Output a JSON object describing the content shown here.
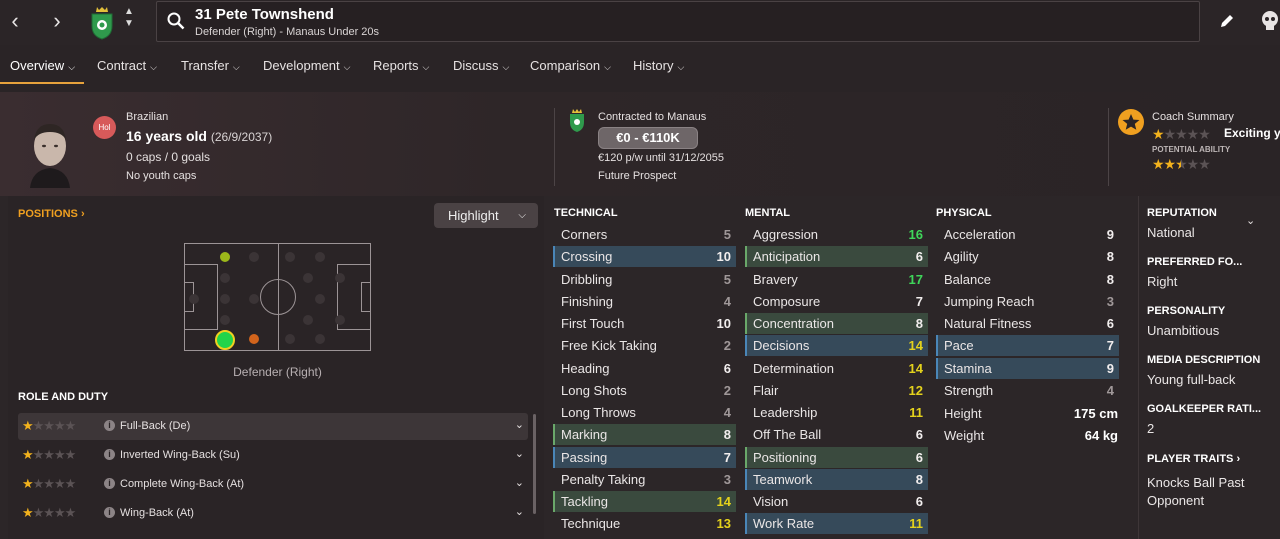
{
  "header": {
    "player_title": "31 Pete Townshend",
    "player_subtitle": "Defender (Right) - Manaus Under 20s"
  },
  "tabs": [
    {
      "label": "Overview"
    },
    {
      "label": "Contract"
    },
    {
      "label": "Transfer"
    },
    {
      "label": "Development"
    },
    {
      "label": "Reports"
    },
    {
      "label": "Discuss"
    },
    {
      "label": "Comparison"
    },
    {
      "label": "History"
    }
  ],
  "profile": {
    "nationality": "Brazilian",
    "nation_code": "Hol",
    "age": "16 years old",
    "dob": "(26/9/2037)",
    "caps": "0 caps / 0 goals",
    "youth_caps": "No youth caps"
  },
  "contract": {
    "contracted": "Contracted to Manaus",
    "value": "€0 - €110K",
    "wage": "€120 p/w until 31/12/2055",
    "status": "Future Prospect"
  },
  "coach": {
    "title": "Coach Summary",
    "verdict": "Exciting y",
    "current_stars": 1,
    "pa_label": "POTENTIAL ABILITY",
    "potential_stars": 2.5
  },
  "positions": {
    "link": "POSITIONS",
    "highlight_label": "Highlight",
    "caption": "Defender (Right)"
  },
  "roles": {
    "title": "ROLE AND DUTY",
    "items": [
      {
        "name": "Full-Back (De)",
        "stars": 1
      },
      {
        "name": "Inverted Wing-Back (Su)",
        "stars": 1
      },
      {
        "name": "Complete Wing-Back (At)",
        "stars": 1
      },
      {
        "name": "Wing-Back (At)",
        "stars": 1
      }
    ]
  },
  "technical": {
    "title": "TECHNICAL",
    "attrs": [
      {
        "name": "Corners",
        "value": "5",
        "hl": ""
      },
      {
        "name": "Crossing",
        "value": "10",
        "hl": "blue"
      },
      {
        "name": "Dribbling",
        "value": "5",
        "hl": ""
      },
      {
        "name": "Finishing",
        "value": "4",
        "hl": ""
      },
      {
        "name": "First Touch",
        "value": "10",
        "hl": ""
      },
      {
        "name": "Free Kick Taking",
        "value": "2",
        "hl": ""
      },
      {
        "name": "Heading",
        "value": "6",
        "hl": ""
      },
      {
        "name": "Long Shots",
        "value": "2",
        "hl": ""
      },
      {
        "name": "Long Throws",
        "value": "4",
        "hl": ""
      },
      {
        "name": "Marking",
        "value": "8",
        "hl": "green"
      },
      {
        "name": "Passing",
        "value": "7",
        "hl": "blue"
      },
      {
        "name": "Penalty Taking",
        "value": "3",
        "hl": ""
      },
      {
        "name": "Tackling",
        "value": "14",
        "hl": "green"
      },
      {
        "name": "Technique",
        "value": "13",
        "hl": ""
      }
    ]
  },
  "mental": {
    "title": "MENTAL",
    "attrs": [
      {
        "name": "Aggression",
        "value": "16",
        "hl": ""
      },
      {
        "name": "Anticipation",
        "value": "6",
        "hl": "green"
      },
      {
        "name": "Bravery",
        "value": "17",
        "hl": ""
      },
      {
        "name": "Composure",
        "value": "7",
        "hl": ""
      },
      {
        "name": "Concentration",
        "value": "8",
        "hl": "green"
      },
      {
        "name": "Decisions",
        "value": "14",
        "hl": "blue"
      },
      {
        "name": "Determination",
        "value": "14",
        "hl": ""
      },
      {
        "name": "Flair",
        "value": "12",
        "hl": ""
      },
      {
        "name": "Leadership",
        "value": "11",
        "hl": ""
      },
      {
        "name": "Off The Ball",
        "value": "6",
        "hl": ""
      },
      {
        "name": "Positioning",
        "value": "6",
        "hl": "green"
      },
      {
        "name": "Teamwork",
        "value": "8",
        "hl": "blue"
      },
      {
        "name": "Vision",
        "value": "6",
        "hl": ""
      },
      {
        "name": "Work Rate",
        "value": "11",
        "hl": "blue"
      }
    ]
  },
  "physical": {
    "title": "PHYSICAL",
    "attrs": [
      {
        "name": "Acceleration",
        "value": "9",
        "hl": ""
      },
      {
        "name": "Agility",
        "value": "8",
        "hl": ""
      },
      {
        "name": "Balance",
        "value": "8",
        "hl": ""
      },
      {
        "name": "Jumping Reach",
        "value": "3",
        "hl": ""
      },
      {
        "name": "Natural Fitness",
        "value": "6",
        "hl": ""
      },
      {
        "name": "Pace",
        "value": "7",
        "hl": "blue"
      },
      {
        "name": "Stamina",
        "value": "9",
        "hl": "blue"
      },
      {
        "name": "Strength",
        "value": "4",
        "hl": ""
      }
    ],
    "height_label": "Height",
    "height_value": "175 cm",
    "weight_label": "Weight",
    "weight_value": "64 kg"
  },
  "info": {
    "reputation_label": "REPUTATION",
    "reputation_value": "National",
    "foot_label": "PREFERRED FO...",
    "foot_value": "Right",
    "personality_label": "PERSONALITY",
    "personality_value": "Unambitious",
    "media_label": "MEDIA DESCRIPTION",
    "media_value": "Young full-back",
    "gk_label": "GOALKEEPER RATI...",
    "gk_value": "2",
    "traits_label": "PLAYER TRAITS",
    "traits_value_1": "Knocks Ball Past",
    "traits_value_2": "Opponent"
  },
  "colors": {
    "accent": "#f0a020",
    "value_green": "#3fd65a",
    "value_yellow": "#e4d21c",
    "highlight_blue": "#364a5a",
    "highlight_green": "#3a4a3e"
  }
}
